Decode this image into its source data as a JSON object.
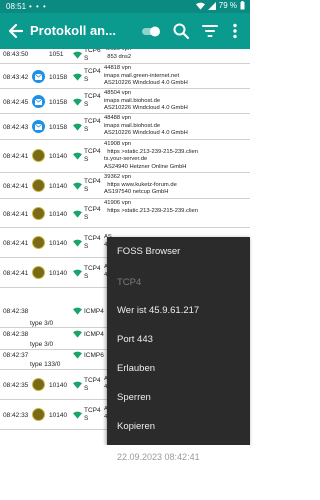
{
  "status_bar": {
    "time": "08:51",
    "dots": "• • •",
    "battery_label": "79 %",
    "icons": [
      "wifi-icon",
      "signal-icon",
      "battery-icon"
    ]
  },
  "app_bar": {
    "title": "Protokoll an...",
    "icons": [
      "back-arrow-icon",
      "toggle-switch-icon",
      "search-icon",
      "filter-icon",
      "overflow-menu-icon"
    ],
    "colors": {
      "bar": "#0a9a8e",
      "status": "#0a8a80",
      "toggle": "#8fd3ca"
    }
  },
  "log_rows": [
    {
      "time": "08:43:50",
      "uid": "1051",
      "proto": "TCP6\nS",
      "info": "42630 vpn\n  853 dns2",
      "icon": "none"
    },
    {
      "time": "08:43:42",
      "uid": "10158",
      "proto": "TCP4\nS",
      "info": "44818 vpn\nimaps mail.green-internet.net\nAS210226 Windcloud 4.0 GmbH",
      "icon": "mail-app-icon"
    },
    {
      "time": "08:42:45",
      "uid": "10158",
      "proto": "TCP4\nS",
      "info": "48504 vpn\nimaps mail.biohost.de\nAS210226 Windcloud 4.0 GmbH",
      "icon": "mail-app-icon"
    },
    {
      "time": "08:42:43",
      "uid": "10158",
      "proto": "TCP4\nS",
      "info": "48488 vpn\nimaps mail.biohost.de\nAS210226 Windcloud 4.0 GmbH",
      "icon": "mail-app-icon"
    },
    {
      "time": "08:42:41",
      "uid": "10140",
      "proto": "TCP4\nS",
      "info": "41908 vpn\n  https >static.213-239-215-239.clien\nts.your-server.de\nAS24940 Hetzner Online GmbH",
      "icon": "foss-browser-icon"
    },
    {
      "time": "08:42:41",
      "uid": "10140",
      "proto": "TCP4\nS",
      "info": "39362 vpn\n  https www.kuketz-forum.de\nAS197540 netcup GmbH",
      "icon": "foss-browser-icon"
    },
    {
      "time": "08:42:41",
      "uid": "10140",
      "proto": "TCP4\nS",
      "info": "41906 vpn\n  https >static.213-239-215-239.clien",
      "icon": "foss-browser-icon"
    },
    {
      "time": "08:42:41",
      "uid": "10140",
      "proto": "TCP4\nS",
      "info": "AS\n4",
      "icon": "foss-browser-icon"
    },
    {
      "time": "08:42:41",
      "uid": "10140",
      "proto": "TCP4\nS",
      "info": "AS\n4",
      "icon": "foss-browser-icon"
    },
    {
      "time": "08:42:38",
      "uid": "",
      "proto": "ICMP4",
      "info": "",
      "sub": "type 3/0",
      "icon": "none"
    },
    {
      "time": "08:42:38",
      "uid": "",
      "proto": "ICMP4",
      "info": "",
      "sub": "type 3/0",
      "icon": "none"
    },
    {
      "time": "08:42:37",
      "uid": "",
      "proto": "ICMP6",
      "info": "",
      "sub": "type 133/0",
      "icon": "none"
    },
    {
      "time": "08:42:35",
      "uid": "10140",
      "proto": "TCP4\nS",
      "info": "AS\n4",
      "icon": "foss-browser-icon"
    },
    {
      "time": "08:42:33",
      "uid": "10140",
      "proto": "TCP4\nS",
      "info": "AS\n4",
      "icon": "foss-browser-icon"
    }
  ],
  "context_menu": {
    "app_name": "FOSS Browser",
    "protocol": "TCP4",
    "whois": "Wer ist 45.9.61.217",
    "port": "Port 443",
    "allow": "Erlauben",
    "block": "Sperren",
    "copy": "Kopieren",
    "timestamp": "22.09.2023 08:42:41"
  }
}
